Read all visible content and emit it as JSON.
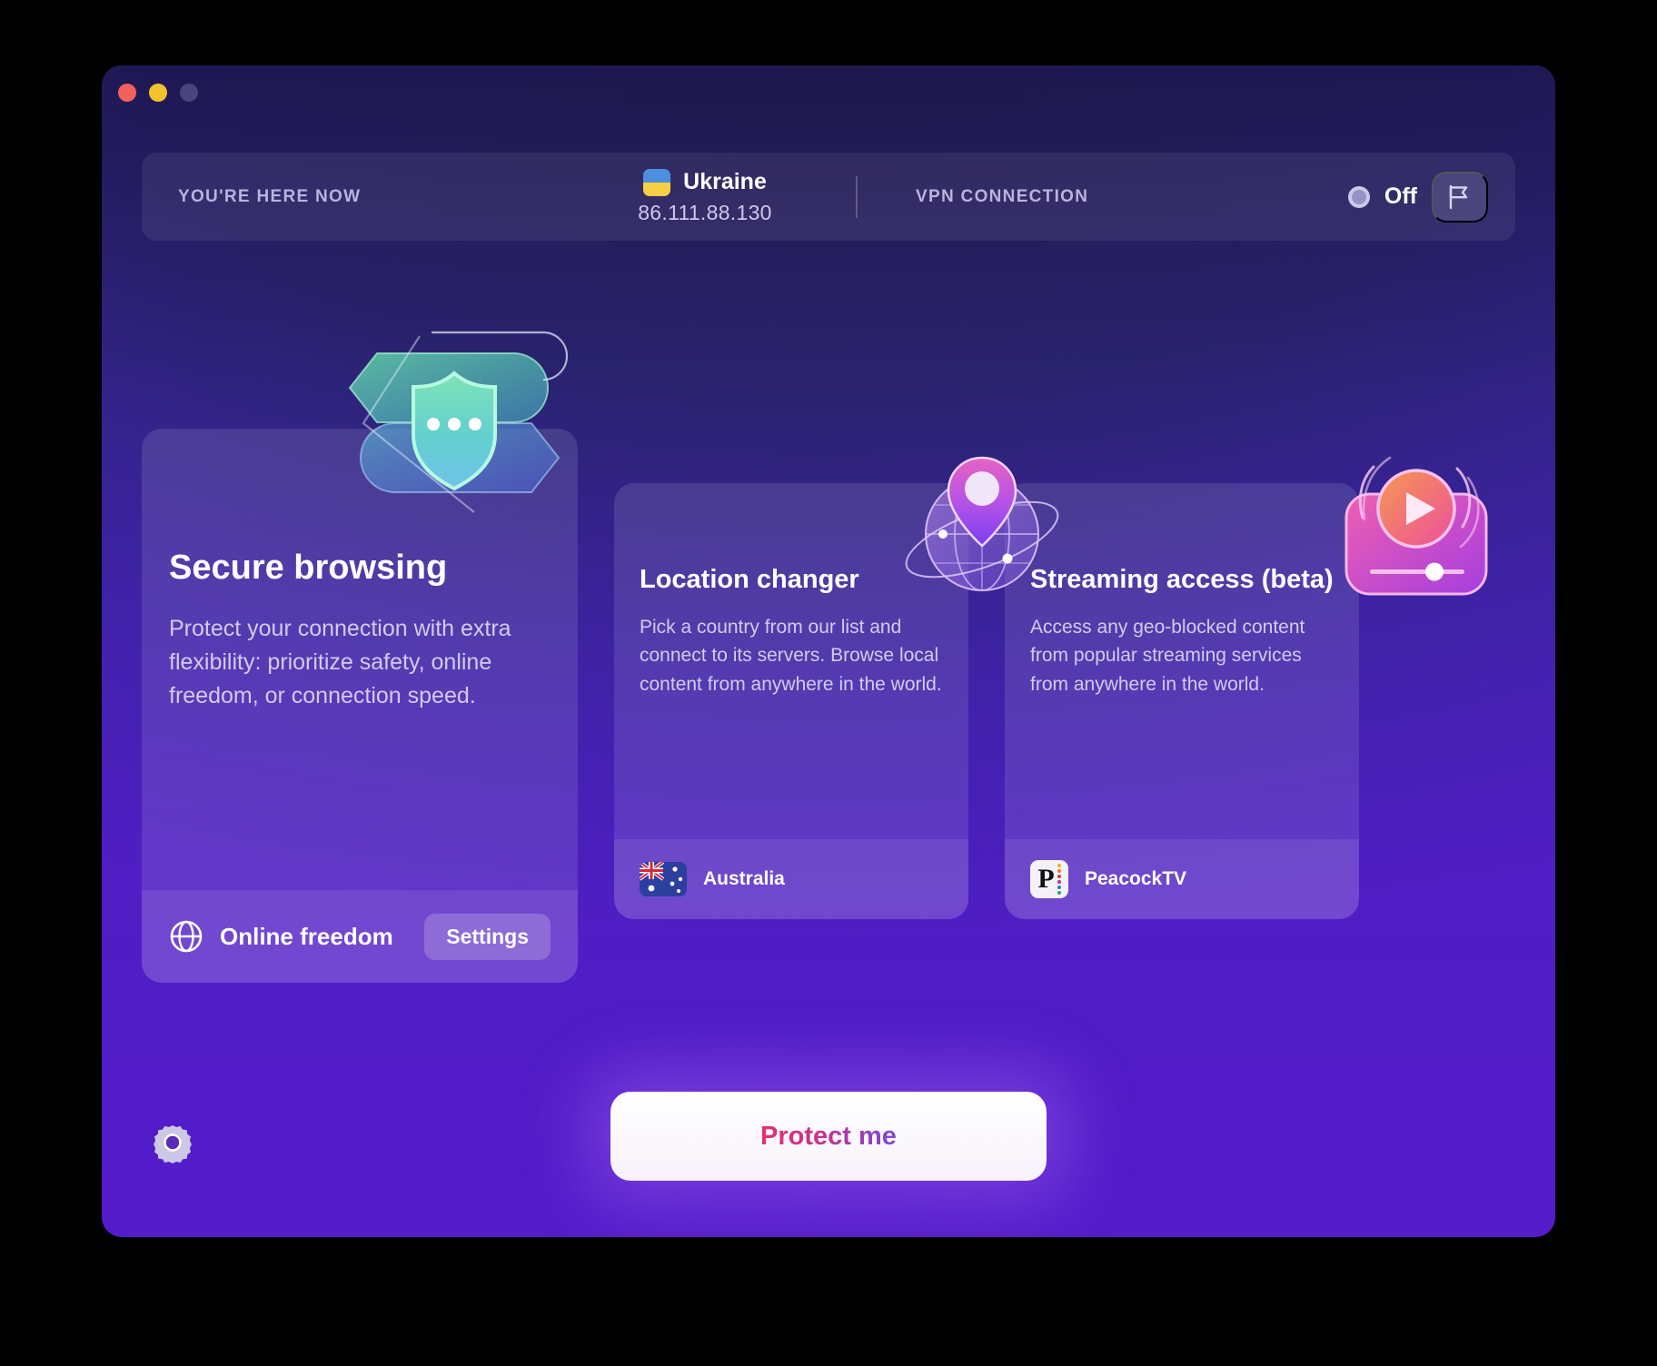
{
  "window": {
    "traffic_lights": [
      "close",
      "minimize",
      "zoom"
    ]
  },
  "status_bar": {
    "here_label": "YOU'RE HERE NOW",
    "country": "Ukraine",
    "country_flag": "ukraine-flag-icon",
    "ip_address": "86.111.88.130",
    "vpn_label": "VPN CONNECTION",
    "vpn_state": "Off",
    "flag_button_icon": "flag-icon"
  },
  "cards": [
    {
      "id": "secure-browsing",
      "title": "Secure browsing",
      "description": "Protect your connection with extra flexibility: prioritize safety, online freedom, or connection speed.",
      "illustration": "shield-lock-icon",
      "footer_icon": "globe-icon",
      "footer_label": "Online freedom",
      "action_label": "Settings"
    },
    {
      "id": "location-changer",
      "title": "Location changer",
      "description": "Pick a country from our list and connect to its servers. Browse local content from anywhere in the world.",
      "illustration": "globe-pin-icon",
      "footer_icon": "australia-flag-icon",
      "footer_label": "Australia"
    },
    {
      "id": "streaming-access",
      "title": "Streaming access (beta)",
      "description": "Access any geo-blocked content from popular streaming services from anywhere in the world.",
      "illustration": "media-player-icon",
      "footer_icon": "peacocktv-logo-icon",
      "footer_label": "PeacockTV"
    }
  ],
  "footer": {
    "settings_icon": "gear-icon",
    "primary_action": "Protect me"
  },
  "colors": {
    "background_top": "#241f5c",
    "background_bottom": "#5116c8",
    "accent_pink": "#e8306f",
    "accent_purple": "#7b48d6",
    "traffic_red": "#f2615c",
    "traffic_yellow": "#f5c12e",
    "traffic_grey": "#4a437e"
  }
}
